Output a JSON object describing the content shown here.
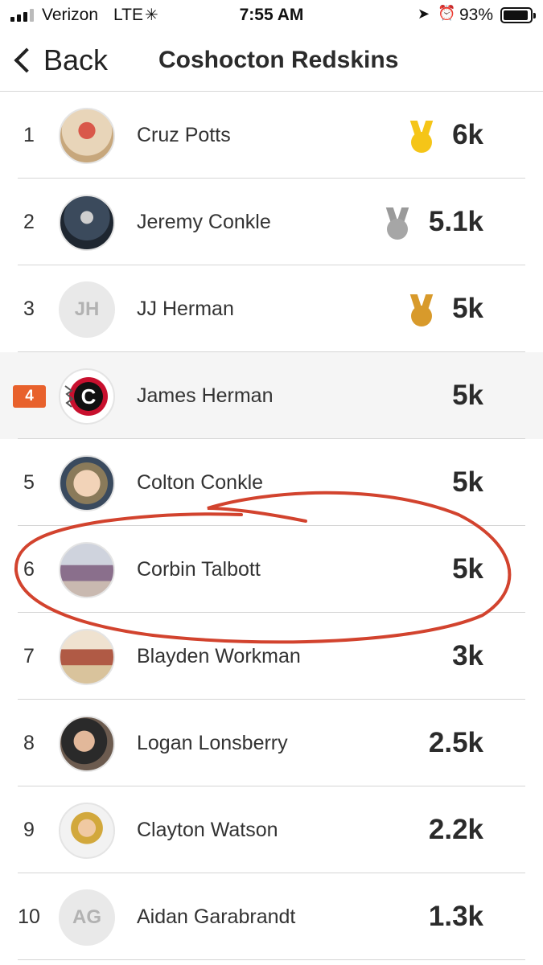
{
  "status_bar": {
    "carrier": "Verizon",
    "network": "LTE",
    "activity_icon": "activity-spinner-icon",
    "time": "7:55 AM",
    "battery_percent": "93%",
    "battery_level": 0.93
  },
  "nav": {
    "back_label": "Back",
    "title": "Coshocton Redskins"
  },
  "colors": {
    "rank_badge": "#e8612c",
    "gold": "#f5c518",
    "silver": "#a6a6a6",
    "bronze": "#d89a2b",
    "annotation": "#d2432e"
  },
  "rows": [
    {
      "rank": "1",
      "name": "Cruz Potts",
      "score": "6k",
      "avatar": "photo",
      "medal": "gold"
    },
    {
      "rank": "2",
      "name": "Jeremy Conkle",
      "score": "5.1k",
      "avatar": "photo",
      "medal": "silver"
    },
    {
      "rank": "3",
      "name": "JJ Herman",
      "score": "5k",
      "avatar": "initials",
      "initials": "JH",
      "medal": "bronze"
    },
    {
      "rank": "4",
      "name": "James Herman",
      "score": "5k",
      "avatar": "logo",
      "highlight": true
    },
    {
      "rank": "5",
      "name": "Colton Conkle",
      "score": "5k",
      "avatar": "photo"
    },
    {
      "rank": "6",
      "name": "Corbin Talbott",
      "score": "5k",
      "avatar": "photo"
    },
    {
      "rank": "7",
      "name": "Blayden Workman",
      "score": "3k",
      "avatar": "photo"
    },
    {
      "rank": "8",
      "name": "Logan Lonsberry",
      "score": "2.5k",
      "avatar": "photo"
    },
    {
      "rank": "9",
      "name": "Clayton Watson",
      "score": "2.2k",
      "avatar": "photo"
    },
    {
      "rank": "10",
      "name": "Aidan Garabrandt",
      "score": "1.3k",
      "avatar": "initials",
      "initials": "AG"
    }
  ]
}
